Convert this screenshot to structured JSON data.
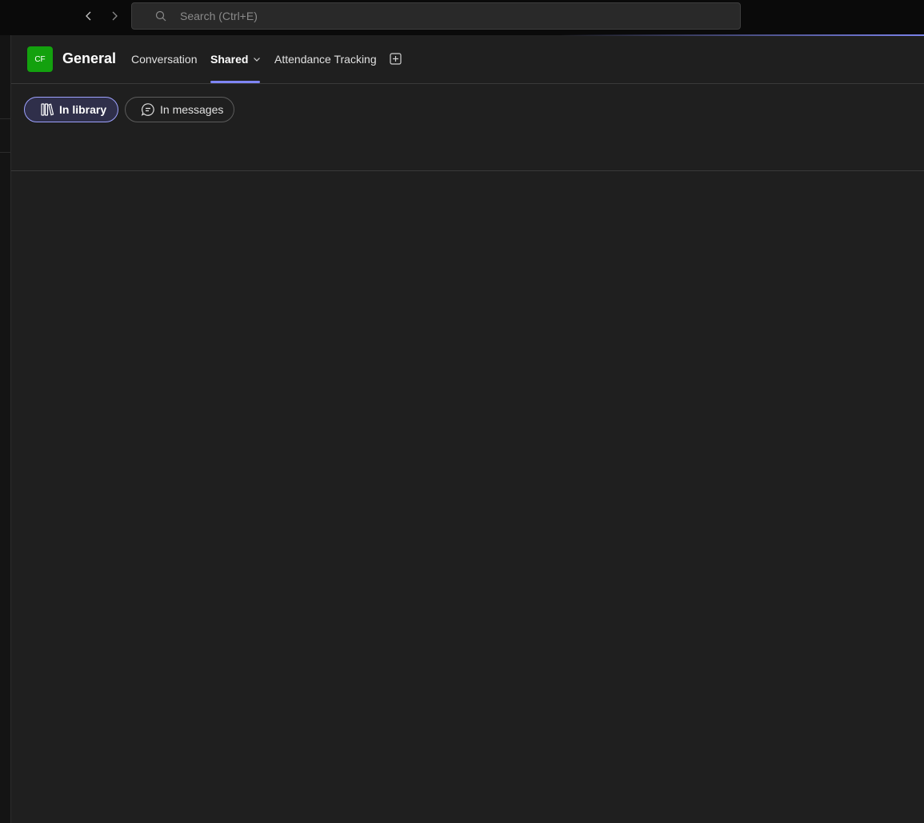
{
  "topbar": {
    "search_placeholder": "Search (Ctrl+E)"
  },
  "header": {
    "team_initials": "CF",
    "channel_title": "General",
    "tabs": [
      {
        "label": "Conversation",
        "active": false
      },
      {
        "label": "Shared",
        "active": true
      },
      {
        "label": "Attendance Tracking",
        "active": false
      }
    ]
  },
  "filters": {
    "in_library": "In library",
    "in_messages": "In messages",
    "selected": "In library"
  },
  "colors": {
    "accent": "#7f85f5",
    "avatar_bg": "#13a10e",
    "background": "#1f1f1f"
  }
}
